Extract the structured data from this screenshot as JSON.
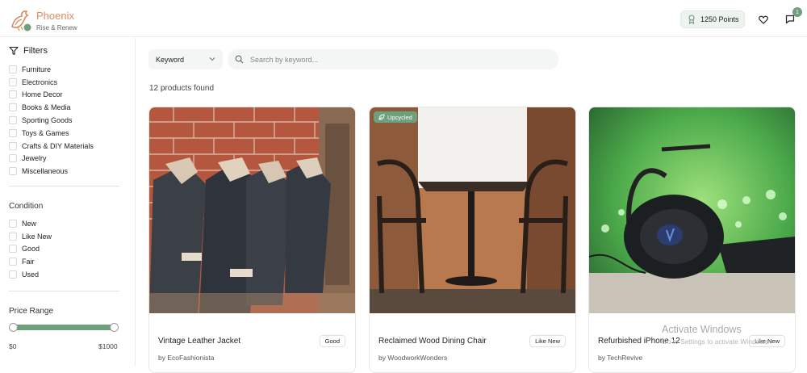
{
  "brand": {
    "name": "Phoenix",
    "tagline": "Rise & Renew"
  },
  "header": {
    "points_label": "1250 Points",
    "messages_badge": "1"
  },
  "sidebar": {
    "filters_title": "Filters",
    "categories": [
      "Furniture",
      "Electronics",
      "Home Decor",
      "Books & Media",
      "Sporting Goods",
      "Toys & Games",
      "Crafts & DIY Materials",
      "Jewelry",
      "Miscellaneous"
    ],
    "condition_title": "Condition",
    "conditions": [
      "New",
      "Like New",
      "Good",
      "Fair",
      "Used"
    ],
    "price_title": "Price Range",
    "price_min": "$0",
    "price_max": "$1000",
    "price_range_selected": [
      0,
      1000
    ]
  },
  "search": {
    "mode_selected": "Keyword",
    "placeholder": "Search by keyword...",
    "value": ""
  },
  "results": {
    "count_text": "12 products found"
  },
  "products": [
    {
      "title": "Vintage Leather Jacket",
      "seller": "by EcoFashionista",
      "condition": "Good",
      "tag": ""
    },
    {
      "title": "Reclaimed Wood Dining Chair",
      "seller": "by WoodworkWonders",
      "condition": "Like New",
      "tag": "Upcycled"
    },
    {
      "title": "Refurbished iPhone 12",
      "seller": "by TechRevive",
      "condition": "Like New",
      "tag": ""
    }
  ],
  "watermark": {
    "line1": "Activate Windows",
    "line2": "Go to Settings to activate Windows."
  },
  "colors": {
    "accent": "#6fa07d",
    "brand": "#d98c5f",
    "border": "#ececec"
  }
}
